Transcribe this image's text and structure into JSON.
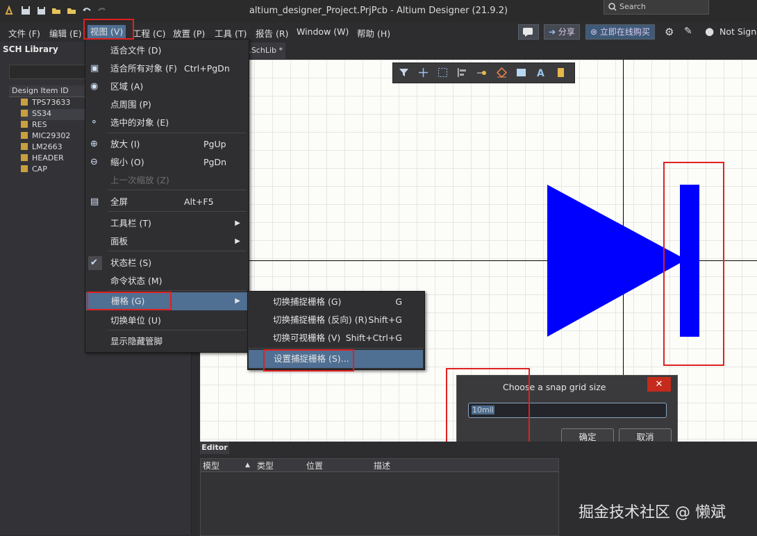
{
  "window": {
    "title": "altium_designer_Project.PrjPcb - Altium Designer (21.9.2)",
    "search_placeholder": "Search"
  },
  "menubar": {
    "items": [
      "文件 (F)",
      "编辑 (E)",
      "视图 (V)",
      "工程 (C)",
      "放置 (P)",
      "工具 (T)",
      "报告 (R)",
      "Window (W)",
      "帮助 (H)"
    ],
    "share_label": "分享",
    "buy_label": "立即在线购买",
    "signin_label": "Not Signed"
  },
  "left_panel": {
    "title": "SCH Library",
    "column_header": "Design Item ID",
    "items": [
      "TPS73633",
      "SS34",
      "RES",
      "MIC29302",
      "LM2663",
      "HEADER",
      "CAP"
    ],
    "selected_index": 1
  },
  "document_tab": "E.SchLib *",
  "view_menu": {
    "items": [
      {
        "label": "适合文件 (D)",
        "shortcut": ""
      },
      {
        "label": "适合所有对象 (F)",
        "shortcut": "Ctrl+PgDn"
      },
      {
        "label": "区域 (A)",
        "shortcut": ""
      },
      {
        "label": "点周围 (P)",
        "shortcut": ""
      },
      {
        "label": "选中的对象 (E)",
        "shortcut": ""
      },
      {
        "label": "放大 (I)",
        "shortcut": "PgUp"
      },
      {
        "label": "缩小 (O)",
        "shortcut": "PgDn"
      },
      {
        "label": "上一次缩放 (Z)",
        "shortcut": ""
      },
      {
        "label": "全屏",
        "shortcut": "Alt+F5"
      },
      {
        "label": "工具栏 (T)",
        "shortcut": ""
      },
      {
        "label": "面板",
        "shortcut": ""
      },
      {
        "label": "状态栏 (S)",
        "shortcut": ""
      },
      {
        "label": "命令状态 (M)",
        "shortcut": ""
      },
      {
        "label": "栅格 (G)",
        "shortcut": ""
      },
      {
        "label": "切换单位 (U)",
        "shortcut": ""
      },
      {
        "label": "显示隐藏管脚",
        "shortcut": ""
      }
    ]
  },
  "grid_submenu": {
    "items": [
      {
        "label": "切换捕捉栅格 (G)",
        "shortcut": "G"
      },
      {
        "label": "切换捕捉栅格 (反向) (R)",
        "shortcut": "Shift+G"
      },
      {
        "label": "切换可视栅格 (V)",
        "shortcut": "Shift+Ctrl+G"
      },
      {
        "label": "设置捕捉栅格 (S)...",
        "shortcut": ""
      }
    ]
  },
  "dialog": {
    "title": "Choose a snap grid size",
    "close": "✕",
    "value": "10mil",
    "ok": "确定",
    "cancel": "取消"
  },
  "editor": {
    "tab": "Editor",
    "columns": [
      "模型",
      "类型",
      "位置",
      "描述"
    ]
  },
  "watermark": "掘金技术社区 @ 懒斌",
  "colors": {
    "accent": "#4f6f93",
    "highlight_box": "#e02020",
    "diode": "#0000ff"
  }
}
